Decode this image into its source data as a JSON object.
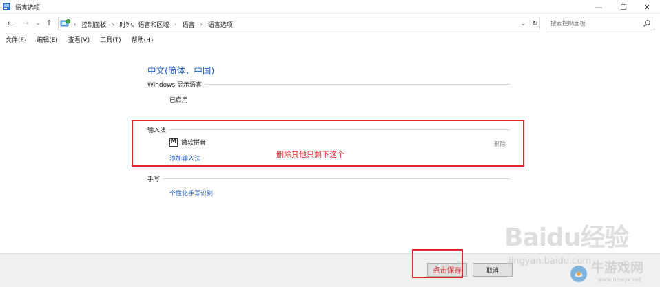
{
  "window": {
    "title": "语言选项",
    "minimize": "—",
    "maximize": "☐",
    "close": "✕"
  },
  "nav": {
    "back": "←",
    "forward": "→",
    "recent": "⌄",
    "up": "↑"
  },
  "address": {
    "breadcrumbs": [
      "控制面板",
      "时钟、语言和区域",
      "语言",
      "语言选项"
    ],
    "separator": "›",
    "dropdown": "⌄",
    "refresh": "↻"
  },
  "search": {
    "placeholder": "搜索控制面板"
  },
  "menu": {
    "items": [
      "文件(F)",
      "编辑(E)",
      "查看(V)",
      "工具(T)",
      "帮助(H)"
    ]
  },
  "content": {
    "language_title": "中文(简体，中国)",
    "display_language": {
      "heading": "Windows 显示语言",
      "status": "已启用"
    },
    "input_method": {
      "heading": "输入法",
      "ime_icon": "M",
      "ime_name": "微软拼音",
      "delete_label": "删除",
      "add_label": "添加输入法"
    },
    "handwriting": {
      "heading": "手写",
      "link": "个性化手写识别"
    },
    "annotation": "删除其他只剩下这个"
  },
  "footer": {
    "save_label": "点击保存",
    "cancel_label": "取消"
  },
  "watermark": {
    "baidu": "Baidu经验",
    "jingyan": "jingyan.baidu.com",
    "site": "牛游戏网",
    "url": "www.newyx.net"
  },
  "colors": {
    "link": "#1f5fb8",
    "annotation": "#e3262d",
    "footer_bg": "#f0f0f0"
  }
}
